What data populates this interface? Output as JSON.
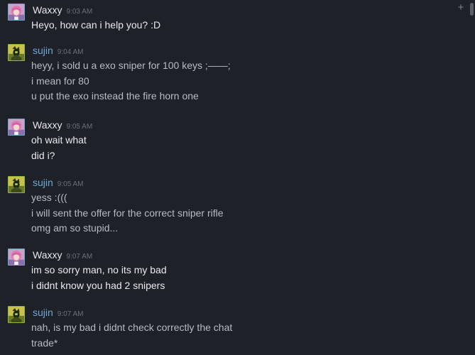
{
  "users": {
    "waxxy": {
      "name": "Waxxy"
    },
    "sujin": {
      "name": "sujin"
    }
  },
  "messages": [
    {
      "sender": "Waxxy",
      "time": "9:03 AM",
      "lines": [
        "Heyo, how can i help you? :D"
      ]
    },
    {
      "sender": "sujin",
      "time": "9:04 AM",
      "lines": [
        "heyy, i sold u a exo sniper for 100 keys ;——;",
        "i mean for 80",
        "u put the exo instead the fire horn one"
      ]
    },
    {
      "sender": "Waxxy",
      "time": "9:05 AM",
      "lines": [
        "oh wait what",
        "did i?"
      ]
    },
    {
      "sender": "sujin",
      "time": "9:05 AM",
      "lines": [
        "yess :(((",
        "i will sent the offer for the correct sniper rifle",
        "omg am so stupid..."
      ]
    },
    {
      "sender": "Waxxy",
      "time": "9:07 AM",
      "lines": [
        "im so sorry man, no its my bad",
        "i didnt know you had 2 snipers"
      ]
    },
    {
      "sender": "sujin",
      "time": "9:07 AM",
      "lines": [
        "nah, is my bad i didnt check correctly the chat",
        "trade*"
      ]
    }
  ],
  "colors": {
    "background": "#1e2128",
    "name_self": "#e6e7e9",
    "name_friend": "#6fa8d6",
    "timestamp": "#6b6f76",
    "text_self": "#e9eaec",
    "text_friend": "#b8bcc2"
  },
  "icons": {
    "add": "plus-icon",
    "waxxy_avatar": "pink-hair-anime-girl-avatar",
    "sujin_avatar": "green-yellow-character-avatar"
  }
}
